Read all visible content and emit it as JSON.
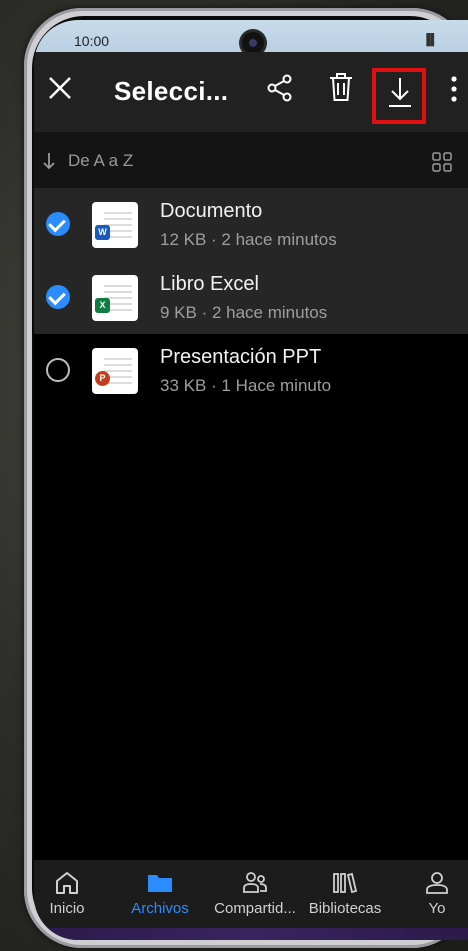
{
  "status": {
    "time": "10:00",
    "signal": "▐▌"
  },
  "toolbar": {
    "title": "Selecci...",
    "close_icon": "close-icon",
    "share_icon": "share-icon",
    "delete_icon": "trash-icon",
    "download_icon": "download-icon",
    "more_icon": "more-vertical-icon"
  },
  "sort": {
    "label": "De A a Z"
  },
  "files": [
    {
      "name": "Documento",
      "meta": "12 KB · 2 hace minutos",
      "type": "W",
      "color": "#185abd",
      "selected": true
    },
    {
      "name": "Libro Excel",
      "meta": "9 KB · 2 hace minutos",
      "type": "X",
      "color": "#107c41",
      "selected": true
    },
    {
      "name": "Presentación PPT",
      "meta": "33 KB · 1 Hace minuto",
      "type": "P",
      "color": "#c43e1c",
      "selected": false
    }
  ],
  "nav": [
    {
      "label": "Inicio",
      "icon": "home-icon",
      "active": false
    },
    {
      "label": "Archivos",
      "icon": "folder-icon",
      "active": true
    },
    {
      "label": "Compartid...",
      "icon": "people-icon",
      "active": false
    },
    {
      "label": "Bibliotecas",
      "icon": "library-icon",
      "active": false
    },
    {
      "label": "Yo",
      "icon": "person-icon",
      "active": false
    }
  ],
  "colors": {
    "accent": "#2a8cff",
    "highlight": "#e01010"
  }
}
